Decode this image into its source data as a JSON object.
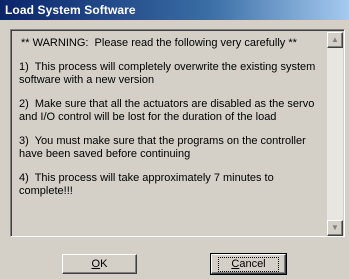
{
  "window": {
    "title": "Load System Software"
  },
  "message": {
    "lines": [
      "** WARNING:  Please read the following very carefully **",
      "1)  This process will completely overwrite the existing system software with a new version",
      "2)  Make sure that all the actuators are disabled as the servo and I/O control will be lost for the duration of the load",
      "3)  You must make sure that the programs on the controller have been saved before continuing",
      "4)  This process will take approximately 7 minutes to complete!!!"
    ]
  },
  "buttons": {
    "ok": {
      "mnemonic": "O",
      "rest": "K"
    },
    "cancel": {
      "mnemonic": "C",
      "rest": "ancel"
    }
  },
  "icons": {
    "scroll_up": "up-arrow-icon",
    "scroll_down": "down-arrow-icon"
  }
}
